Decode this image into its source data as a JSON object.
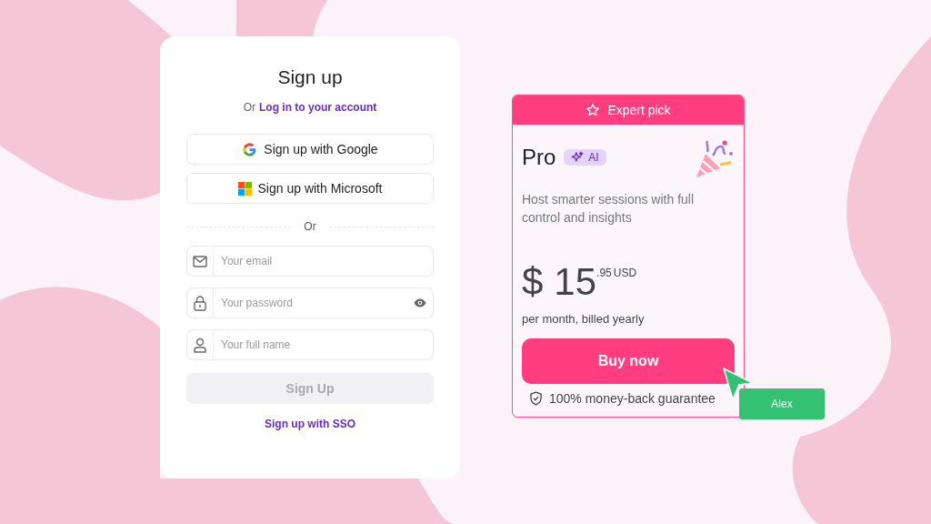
{
  "signup": {
    "title": "Sign up",
    "login_prompt": "Or",
    "login_link": "Log in to your account",
    "providers": [
      {
        "kind": "google",
        "label": "Sign up with Google"
      },
      {
        "kind": "microsoft",
        "label": "Sign up with Microsoft"
      }
    ],
    "divider": "Or",
    "fields": [
      {
        "kind": "email",
        "placeholder": "Your email"
      },
      {
        "kind": "password",
        "placeholder": "Your password"
      },
      {
        "kind": "name",
        "placeholder": "Your full name"
      }
    ],
    "submit": {
      "label": "Sign Up",
      "disabled": true
    },
    "sso_link": "Sign up with SSO"
  },
  "plan": {
    "ribbon": "Expert pick",
    "name": "Pro",
    "badge": "AI",
    "description": "Host smarter sessions with full control and insights",
    "currency": "$",
    "price": "15",
    "cents": ".95",
    "unit": "USD",
    "billing": "per month, billed yearly",
    "cta": "Buy now",
    "guarantee": "100% money-back guarantee"
  },
  "cursor": {
    "label": "Alex"
  }
}
